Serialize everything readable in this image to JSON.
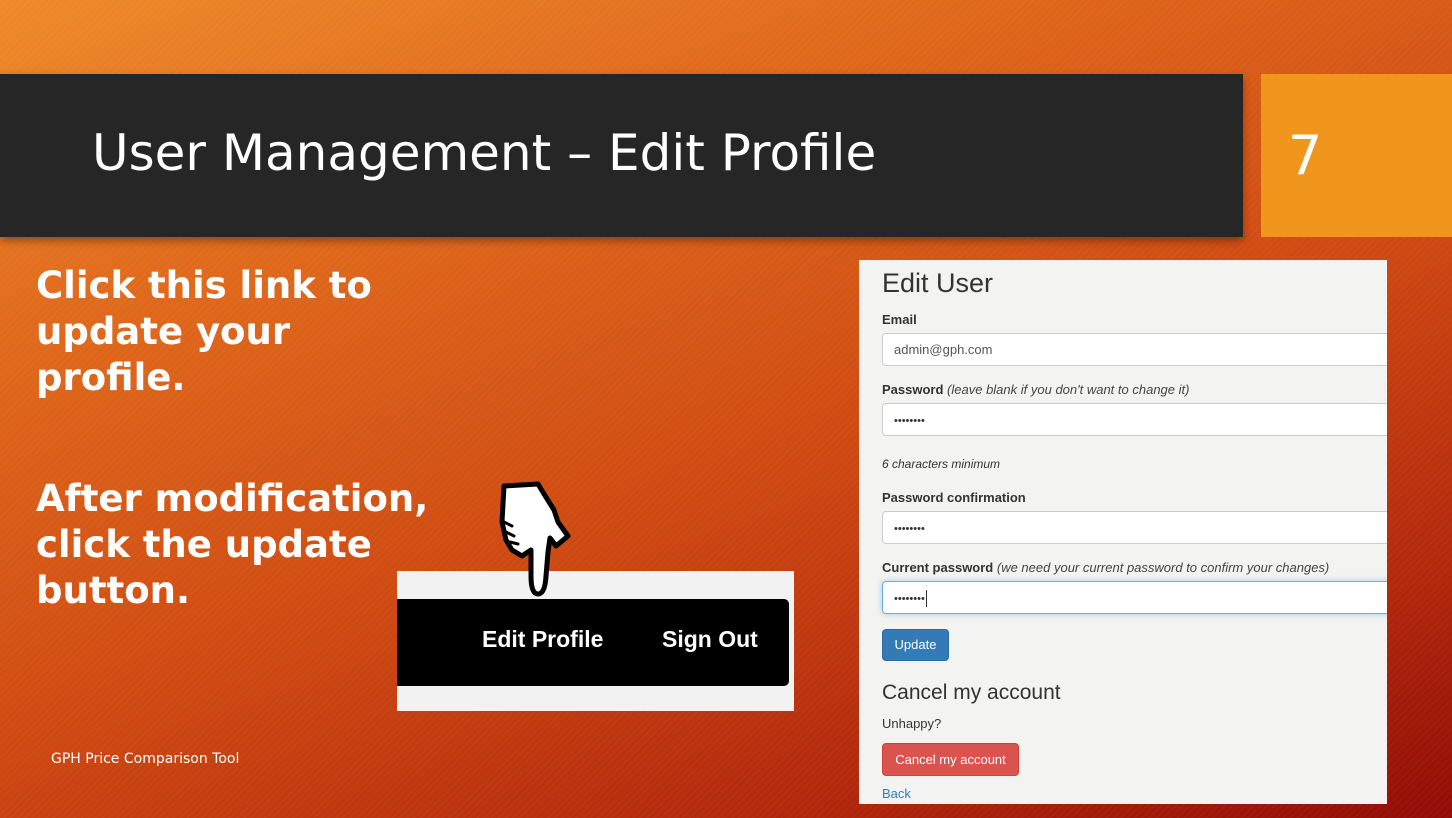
{
  "slide": {
    "title": "User Management – Edit Profile",
    "number": "7",
    "body_1": "Click this link to update your profile.",
    "body_2": "After modification, click the update button.",
    "footer": "GPH Price Comparison Tool"
  },
  "nav": {
    "edit_profile": "Edit Profile",
    "sign_out": "Sign Out"
  },
  "form": {
    "heading": "Edit User",
    "email_label": "Email",
    "email_value": "admin@gph.com",
    "password_label": "Password",
    "password_hint": "(leave blank if you don't want to change it)",
    "password_value": "••••••••",
    "password_min_note": "6 characters minimum",
    "confirm_label": "Password confirmation",
    "confirm_value": "••••••••",
    "current_label": "Current password",
    "current_hint": "(we need your current password to confirm your changes)",
    "current_value": "••••••••",
    "update_button": "Update",
    "cancel_heading": "Cancel my account",
    "unhappy": "Unhappy?",
    "cancel_button": "Cancel my account",
    "back_link": "Back"
  },
  "icons": {
    "pointer_down": "hand-pointing-down-icon",
    "pointer_left": "hand-pointing-left-icon"
  },
  "colors": {
    "title_bar": "#262626",
    "number_box": "#f0961c",
    "update_button": "#337ab7",
    "cancel_button": "#d9534f"
  }
}
